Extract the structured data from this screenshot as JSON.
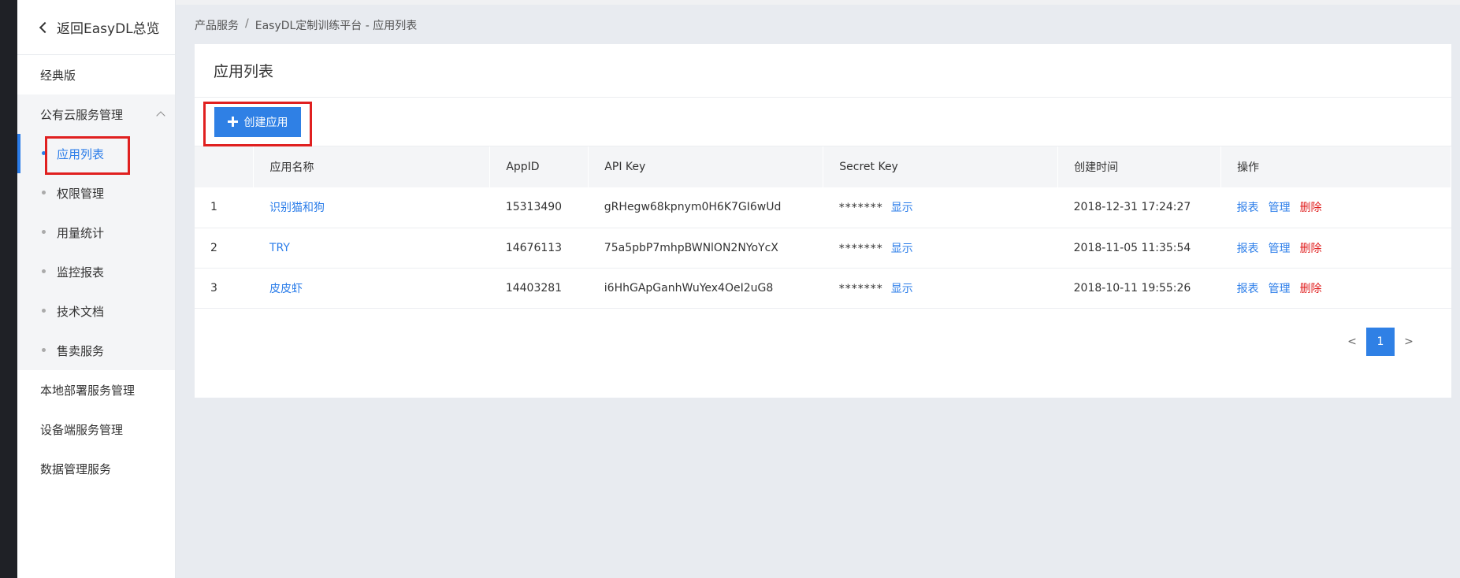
{
  "sidebar": {
    "back_label": "返回EasyDL总览",
    "classic_label": "经典版",
    "group_label": "公有云服务管理",
    "sub_items": [
      {
        "label": "应用列表",
        "active": true
      },
      {
        "label": "权限管理",
        "active": false
      },
      {
        "label": "用量统计",
        "active": false
      },
      {
        "label": "监控报表",
        "active": false
      },
      {
        "label": "技术文档",
        "active": false
      },
      {
        "label": "售卖服务",
        "active": false
      }
    ],
    "bottom_items": [
      "本地部署服务管理",
      "设备端服务管理",
      "数据管理服务"
    ]
  },
  "breadcrumb": {
    "items": [
      "产品服务",
      "EasyDL定制训练平台 - 应用列表"
    ],
    "separator": "/"
  },
  "card": {
    "title": "应用列表",
    "create_button": "创建应用"
  },
  "table": {
    "headers": [
      "",
      "应用名称",
      "AppID",
      "API Key",
      "Secret Key",
      "创建时间",
      "操作"
    ],
    "rows": [
      {
        "index": "1",
        "name": "识别猫和狗",
        "appid": "15313490",
        "api_key": "gRHegw68kpnym0H6K7GI6wUd",
        "secret": "*******",
        "show": "显示",
        "created": "2018-12-31 17:24:27",
        "op_report": "报表",
        "op_manage": "管理",
        "op_delete": "删除"
      },
      {
        "index": "2",
        "name": "TRY",
        "appid": "14676113",
        "api_key": "75a5pbP7mhpBWNlON2NYoYcX",
        "secret": "*******",
        "show": "显示",
        "created": "2018-11-05 11:35:54",
        "op_report": "报表",
        "op_manage": "管理",
        "op_delete": "删除"
      },
      {
        "index": "3",
        "name": "皮皮虾",
        "appid": "14403281",
        "api_key": "i6HhGApGanhWuYex4OeI2uG8",
        "secret": "*******",
        "show": "显示",
        "created": "2018-10-11 19:55:26",
        "op_report": "报表",
        "op_manage": "管理",
        "op_delete": "删除"
      }
    ]
  },
  "pagination": {
    "prev": "<",
    "current": "1",
    "next": ">"
  },
  "colors": {
    "accent": "#2f80e5",
    "link": "#2b7de9",
    "danger": "#e02020",
    "highlight": "#e02020"
  }
}
